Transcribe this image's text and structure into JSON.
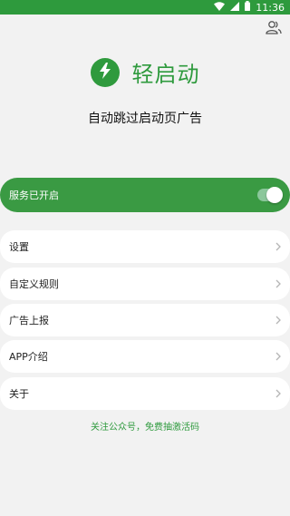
{
  "status_bar": {
    "time": "11:36"
  },
  "header": {
    "app_name": "轻启动",
    "subtitle": "自动跳过启动页广告"
  },
  "service": {
    "label": "服务已开启",
    "enabled": true
  },
  "menu": [
    {
      "label": "设置"
    },
    {
      "label": "自定义规则"
    },
    {
      "label": "广告上报"
    },
    {
      "label": "APP介绍"
    },
    {
      "label": "关于"
    }
  ],
  "footer": {
    "link_text": "关注公众号，免费抽激活码"
  },
  "colors": {
    "accent": "#2e9a3d",
    "background": "#f2f2f2"
  }
}
